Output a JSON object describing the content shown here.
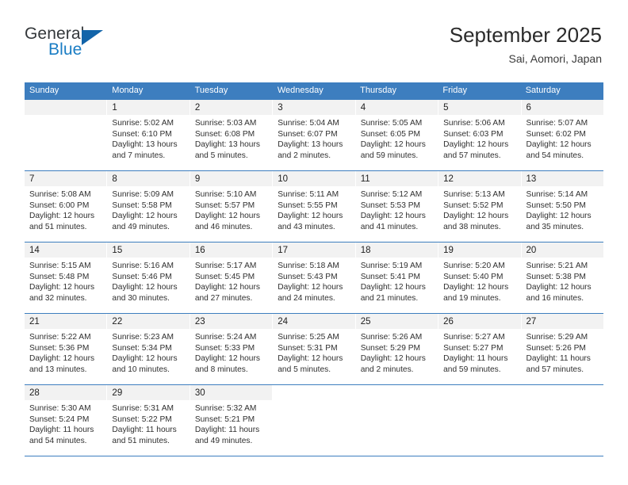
{
  "brand": {
    "name_part1": "General",
    "name_part2": "Blue",
    "triangle_color": "#1264a9",
    "blue_color": "#1a7dc4"
  },
  "header": {
    "title": "September 2025",
    "subtitle": "Sai, Aomori, Japan",
    "accent_color": "#3d7ebf"
  },
  "weekdays": [
    "Sunday",
    "Monday",
    "Tuesday",
    "Wednesday",
    "Thursday",
    "Friday",
    "Saturday"
  ],
  "weeks": [
    [
      {
        "day": "",
        "sunrise": "",
        "sunset": "",
        "daylight_1": "",
        "daylight_2": ""
      },
      {
        "day": "1",
        "sunrise": "Sunrise: 5:02 AM",
        "sunset": "Sunset: 6:10 PM",
        "daylight_1": "Daylight: 13 hours",
        "daylight_2": "and 7 minutes."
      },
      {
        "day": "2",
        "sunrise": "Sunrise: 5:03 AM",
        "sunset": "Sunset: 6:08 PM",
        "daylight_1": "Daylight: 13 hours",
        "daylight_2": "and 5 minutes."
      },
      {
        "day": "3",
        "sunrise": "Sunrise: 5:04 AM",
        "sunset": "Sunset: 6:07 PM",
        "daylight_1": "Daylight: 13 hours",
        "daylight_2": "and 2 minutes."
      },
      {
        "day": "4",
        "sunrise": "Sunrise: 5:05 AM",
        "sunset": "Sunset: 6:05 PM",
        "daylight_1": "Daylight: 12 hours",
        "daylight_2": "and 59 minutes."
      },
      {
        "day": "5",
        "sunrise": "Sunrise: 5:06 AM",
        "sunset": "Sunset: 6:03 PM",
        "daylight_1": "Daylight: 12 hours",
        "daylight_2": "and 57 minutes."
      },
      {
        "day": "6",
        "sunrise": "Sunrise: 5:07 AM",
        "sunset": "Sunset: 6:02 PM",
        "daylight_1": "Daylight: 12 hours",
        "daylight_2": "and 54 minutes."
      }
    ],
    [
      {
        "day": "7",
        "sunrise": "Sunrise: 5:08 AM",
        "sunset": "Sunset: 6:00 PM",
        "daylight_1": "Daylight: 12 hours",
        "daylight_2": "and 51 minutes."
      },
      {
        "day": "8",
        "sunrise": "Sunrise: 5:09 AM",
        "sunset": "Sunset: 5:58 PM",
        "daylight_1": "Daylight: 12 hours",
        "daylight_2": "and 49 minutes."
      },
      {
        "day": "9",
        "sunrise": "Sunrise: 5:10 AM",
        "sunset": "Sunset: 5:57 PM",
        "daylight_1": "Daylight: 12 hours",
        "daylight_2": "and 46 minutes."
      },
      {
        "day": "10",
        "sunrise": "Sunrise: 5:11 AM",
        "sunset": "Sunset: 5:55 PM",
        "daylight_1": "Daylight: 12 hours",
        "daylight_2": "and 43 minutes."
      },
      {
        "day": "11",
        "sunrise": "Sunrise: 5:12 AM",
        "sunset": "Sunset: 5:53 PM",
        "daylight_1": "Daylight: 12 hours",
        "daylight_2": "and 41 minutes."
      },
      {
        "day": "12",
        "sunrise": "Sunrise: 5:13 AM",
        "sunset": "Sunset: 5:52 PM",
        "daylight_1": "Daylight: 12 hours",
        "daylight_2": "and 38 minutes."
      },
      {
        "day": "13",
        "sunrise": "Sunrise: 5:14 AM",
        "sunset": "Sunset: 5:50 PM",
        "daylight_1": "Daylight: 12 hours",
        "daylight_2": "and 35 minutes."
      }
    ],
    [
      {
        "day": "14",
        "sunrise": "Sunrise: 5:15 AM",
        "sunset": "Sunset: 5:48 PM",
        "daylight_1": "Daylight: 12 hours",
        "daylight_2": "and 32 minutes."
      },
      {
        "day": "15",
        "sunrise": "Sunrise: 5:16 AM",
        "sunset": "Sunset: 5:46 PM",
        "daylight_1": "Daylight: 12 hours",
        "daylight_2": "and 30 minutes."
      },
      {
        "day": "16",
        "sunrise": "Sunrise: 5:17 AM",
        "sunset": "Sunset: 5:45 PM",
        "daylight_1": "Daylight: 12 hours",
        "daylight_2": "and 27 minutes."
      },
      {
        "day": "17",
        "sunrise": "Sunrise: 5:18 AM",
        "sunset": "Sunset: 5:43 PM",
        "daylight_1": "Daylight: 12 hours",
        "daylight_2": "and 24 minutes."
      },
      {
        "day": "18",
        "sunrise": "Sunrise: 5:19 AM",
        "sunset": "Sunset: 5:41 PM",
        "daylight_1": "Daylight: 12 hours",
        "daylight_2": "and 21 minutes."
      },
      {
        "day": "19",
        "sunrise": "Sunrise: 5:20 AM",
        "sunset": "Sunset: 5:40 PM",
        "daylight_1": "Daylight: 12 hours",
        "daylight_2": "and 19 minutes."
      },
      {
        "day": "20",
        "sunrise": "Sunrise: 5:21 AM",
        "sunset": "Sunset: 5:38 PM",
        "daylight_1": "Daylight: 12 hours",
        "daylight_2": "and 16 minutes."
      }
    ],
    [
      {
        "day": "21",
        "sunrise": "Sunrise: 5:22 AM",
        "sunset": "Sunset: 5:36 PM",
        "daylight_1": "Daylight: 12 hours",
        "daylight_2": "and 13 minutes."
      },
      {
        "day": "22",
        "sunrise": "Sunrise: 5:23 AM",
        "sunset": "Sunset: 5:34 PM",
        "daylight_1": "Daylight: 12 hours",
        "daylight_2": "and 10 minutes."
      },
      {
        "day": "23",
        "sunrise": "Sunrise: 5:24 AM",
        "sunset": "Sunset: 5:33 PM",
        "daylight_1": "Daylight: 12 hours",
        "daylight_2": "and 8 minutes."
      },
      {
        "day": "24",
        "sunrise": "Sunrise: 5:25 AM",
        "sunset": "Sunset: 5:31 PM",
        "daylight_1": "Daylight: 12 hours",
        "daylight_2": "and 5 minutes."
      },
      {
        "day": "25",
        "sunrise": "Sunrise: 5:26 AM",
        "sunset": "Sunset: 5:29 PM",
        "daylight_1": "Daylight: 12 hours",
        "daylight_2": "and 2 minutes."
      },
      {
        "day": "26",
        "sunrise": "Sunrise: 5:27 AM",
        "sunset": "Sunset: 5:27 PM",
        "daylight_1": "Daylight: 11 hours",
        "daylight_2": "and 59 minutes."
      },
      {
        "day": "27",
        "sunrise": "Sunrise: 5:29 AM",
        "sunset": "Sunset: 5:26 PM",
        "daylight_1": "Daylight: 11 hours",
        "daylight_2": "and 57 minutes."
      }
    ],
    [
      {
        "day": "28",
        "sunrise": "Sunrise: 5:30 AM",
        "sunset": "Sunset: 5:24 PM",
        "daylight_1": "Daylight: 11 hours",
        "daylight_2": "and 54 minutes."
      },
      {
        "day": "29",
        "sunrise": "Sunrise: 5:31 AM",
        "sunset": "Sunset: 5:22 PM",
        "daylight_1": "Daylight: 11 hours",
        "daylight_2": "and 51 minutes."
      },
      {
        "day": "30",
        "sunrise": "Sunrise: 5:32 AM",
        "sunset": "Sunset: 5:21 PM",
        "daylight_1": "Daylight: 11 hours",
        "daylight_2": "and 49 minutes."
      },
      {
        "day": "",
        "sunrise": "",
        "sunset": "",
        "daylight_1": "",
        "daylight_2": ""
      },
      {
        "day": "",
        "sunrise": "",
        "sunset": "",
        "daylight_1": "",
        "daylight_2": ""
      },
      {
        "day": "",
        "sunrise": "",
        "sunset": "",
        "daylight_1": "",
        "daylight_2": ""
      },
      {
        "day": "",
        "sunrise": "",
        "sunset": "",
        "daylight_1": "",
        "daylight_2": ""
      }
    ]
  ]
}
